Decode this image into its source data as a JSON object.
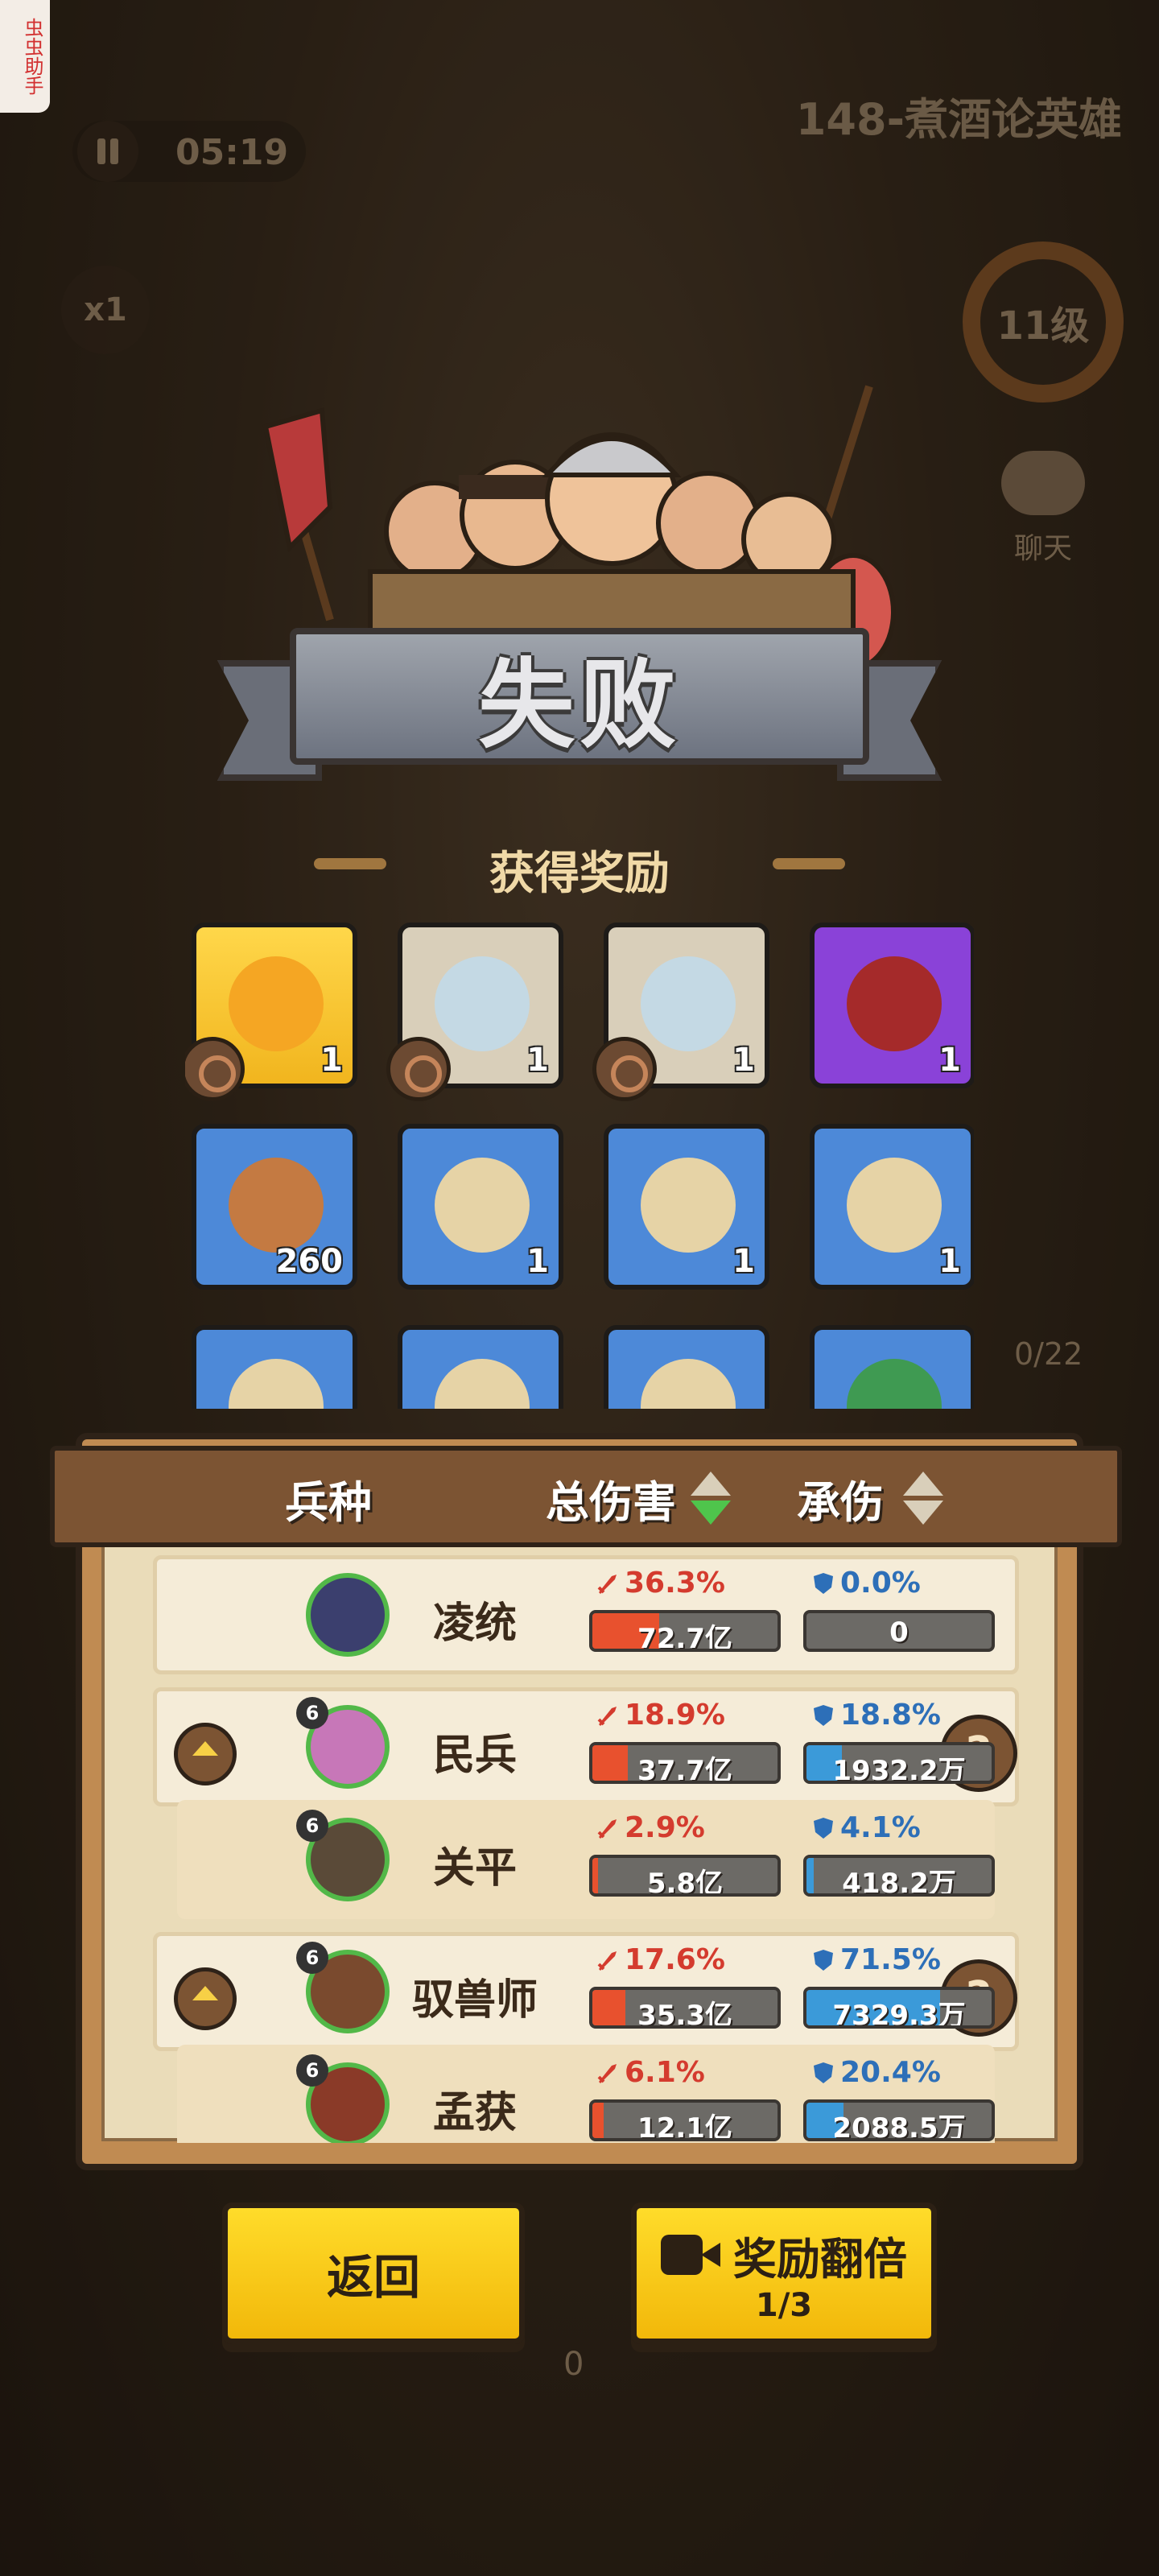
{
  "app": {
    "helper_badge": "虫虫助手",
    "timer": "05:19",
    "speed": "x1",
    "stage_name": "148-煮酒论英雄",
    "player_level": "11级",
    "chat_label": "聊天",
    "troop_count": "0/22",
    "bottom_counter": "0"
  },
  "result": {
    "title": "失败",
    "rewards_heading": "获得奖励"
  },
  "rewards": [
    {
      "count": "1",
      "color": "gold",
      "art": "gold-shell-icon",
      "tag": true
    },
    {
      "count": "1",
      "color": "beige",
      "art": "jade-disc-icon",
      "tag": true
    },
    {
      "count": "1",
      "color": "beige",
      "art": "jade-disc-icon",
      "tag": true
    },
    {
      "count": "1",
      "color": "purple",
      "art": "wine-jar-icon",
      "tag": false
    },
    {
      "count": "260",
      "color": "blue",
      "art": "copper-coin-icon",
      "tag": false
    },
    {
      "count": "1",
      "color": "blue",
      "art": "helmet-scroll-icon",
      "tag": false
    },
    {
      "count": "1",
      "color": "blue",
      "art": "sword-scroll-icon",
      "tag": false
    },
    {
      "count": "1",
      "color": "blue",
      "art": "spin-scroll-icon",
      "tag": false
    },
    {
      "count": "",
      "color": "blue",
      "art": "scroll-icon",
      "tag": false
    },
    {
      "count": "",
      "color": "blue",
      "art": "scroll-icon",
      "tag": false
    },
    {
      "count": "",
      "color": "blue",
      "art": "scroll-icon",
      "tag": false
    },
    {
      "count": "",
      "color": "blue",
      "art": "green-orb-icon",
      "tag": false
    }
  ],
  "stats": {
    "col_unit": "兵种",
    "col_damage": "总伤害",
    "col_tank": "承伤",
    "rows": [
      {
        "name": "凌统",
        "level": "",
        "dmg_pct": "36.3%",
        "dmg_val": "72.7亿",
        "dmg_fill": 0.36,
        "tank_pct": "0.0%",
        "tank_val": "0",
        "tank_fill": 0.0,
        "style": "boxed",
        "group_head": false,
        "avatar_color": "#3b3f6e"
      },
      {
        "name": "民兵",
        "level": "6",
        "dmg_pct": "18.9%",
        "dmg_val": "37.7亿",
        "dmg_fill": 0.19,
        "tank_pct": "18.8%",
        "tank_val": "1932.2万",
        "tank_fill": 0.19,
        "style": "boxed",
        "group_head": true,
        "avatar_color": "#c777b8"
      },
      {
        "name": "关平",
        "level": "6",
        "dmg_pct": "2.9%",
        "dmg_val": "5.8亿",
        "dmg_fill": 0.03,
        "tank_pct": "4.1%",
        "tank_val": "418.2万",
        "tank_fill": 0.04,
        "style": "sub",
        "group_head": false,
        "avatar_color": "#5a4a38"
      },
      {
        "name": "驭兽师",
        "level": "6",
        "dmg_pct": "17.6%",
        "dmg_val": "35.3亿",
        "dmg_fill": 0.18,
        "tank_pct": "71.5%",
        "tank_val": "7329.3万",
        "tank_fill": 0.72,
        "style": "boxed",
        "group_head": true,
        "avatar_color": "#7a4a2e"
      },
      {
        "name": "孟获",
        "level": "6",
        "dmg_pct": "6.1%",
        "dmg_val": "12.1亿",
        "dmg_fill": 0.06,
        "tank_pct": "20.4%",
        "tank_val": "2088.5万",
        "tank_fill": 0.2,
        "style": "sub",
        "group_head": false,
        "avatar_color": "#8a3a28"
      }
    ]
  },
  "buttons": {
    "back": "返回",
    "double": "奖励翻倍",
    "double_count": "1/3"
  }
}
